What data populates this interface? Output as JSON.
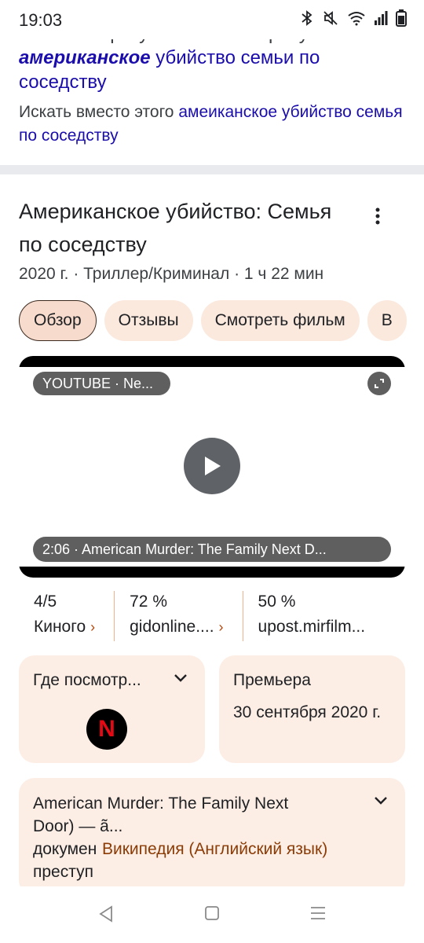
{
  "status": {
    "time": "19:03"
  },
  "correction": {
    "shown_for": "Показаны результаты по запросу",
    "query_bold": "американское",
    "query_rest": " убийство семьи по соседству",
    "instead_label": "Искать вместо этого ",
    "instead_link": "амеиканское убийство семья по соседству"
  },
  "movie": {
    "title": "Американское убийство: Семья по соседству",
    "meta": "2020 г. · Триллер/Криминал · 1 ч 22 мин"
  },
  "tabs": [
    {
      "label": "Обзор"
    },
    {
      "label": "Отзывы"
    },
    {
      "label": "Смотреть фильм"
    },
    {
      "label": "В"
    }
  ],
  "video": {
    "source": "YOUTUBE · Ne...",
    "caption": "2:06 · American Murder: The Family Next D..."
  },
  "ratings": [
    {
      "score": "4/5",
      "source": "Киного"
    },
    {
      "score": "72 %",
      "source": "gidonline...."
    },
    {
      "score": "50 %",
      "source": "upost.mirfilm..."
    }
  ],
  "watch": {
    "title": "Где посмотр...",
    "provider_letter": "N"
  },
  "premiere": {
    "title": "Премьера",
    "date": "30 сентября 2020 г."
  },
  "wiki": {
    "line1": "American Murder: The Family Next",
    "line2": "Door) — ã...",
    "line3": "докумен",
    "line4": "преступ",
    "link": "Википедия (Английский язык)"
  },
  "colors": {
    "link": "#1a0dab",
    "chip_bg": "#fbe9de",
    "card_bg": "#fdeee5",
    "accent_brown": "#8b3b05",
    "divider": "#f3b08c"
  },
  "icons": [
    "bluetooth-icon",
    "mute-icon",
    "wifi-icon",
    "signal-icon",
    "battery-icon",
    "more-vert-icon",
    "expand-icon",
    "play-icon",
    "chevron-right-icon",
    "chevron-down-icon",
    "netflix-logo",
    "back-icon",
    "home-icon",
    "recents-icon"
  ]
}
